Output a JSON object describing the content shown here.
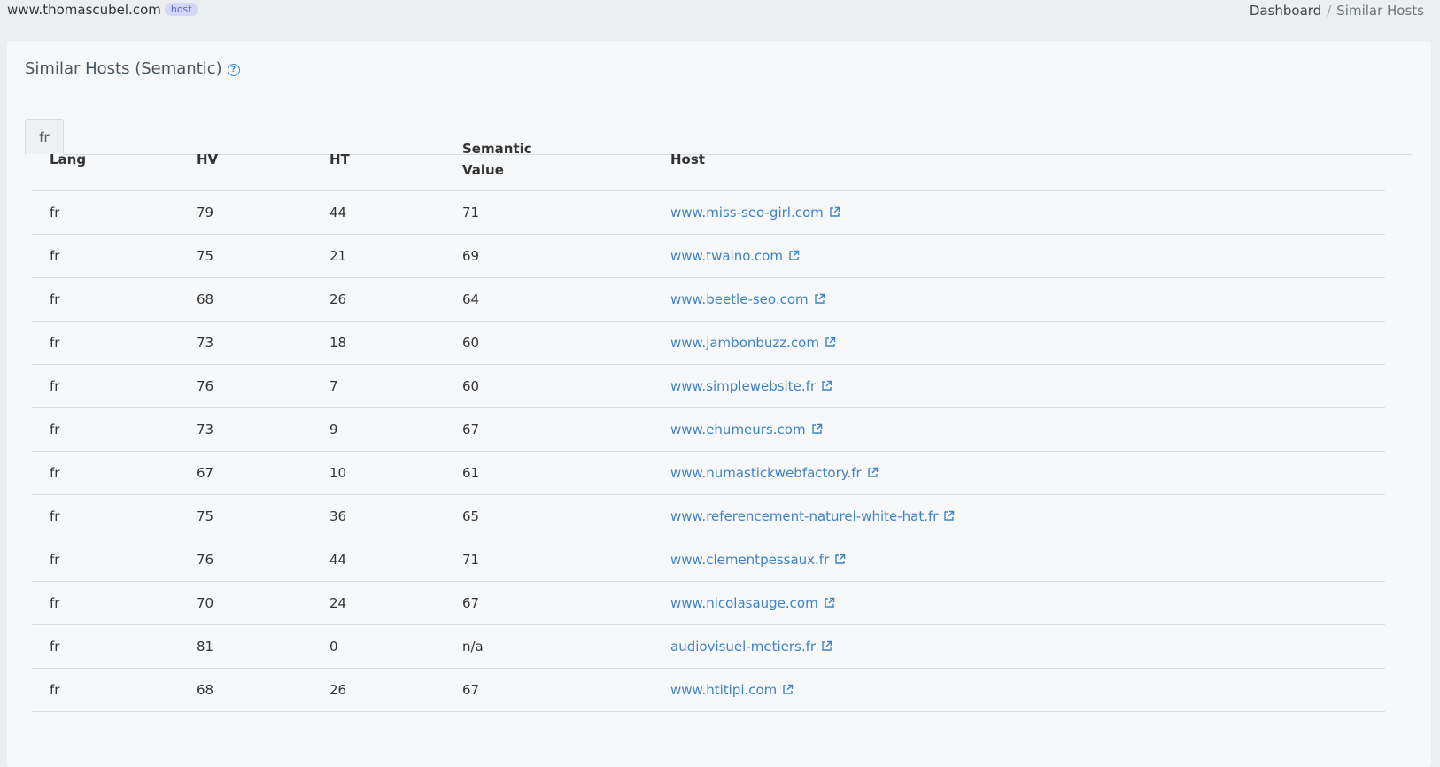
{
  "topbar": {
    "host": "www.thomascubel.com",
    "badge": "host",
    "breadcrumb": [
      "Dashboard",
      "Similar Hosts"
    ]
  },
  "card": {
    "title": "Similar Hosts (Semantic)",
    "help_icon": "question-circle-icon",
    "tabs": [
      {
        "label": "fr"
      }
    ]
  },
  "table": {
    "headers": [
      "Lang",
      "HV",
      "HT",
      "Semantic Value",
      "Host"
    ],
    "rows": [
      {
        "lang": "fr",
        "hv": "79",
        "ht": "44",
        "sem": "71",
        "host": "www.miss-seo-girl.com"
      },
      {
        "lang": "fr",
        "hv": "75",
        "ht": "21",
        "sem": "69",
        "host": "www.twaino.com"
      },
      {
        "lang": "fr",
        "hv": "68",
        "ht": "26",
        "sem": "64",
        "host": "www.beetle-seo.com"
      },
      {
        "lang": "fr",
        "hv": "73",
        "ht": "18",
        "sem": "60",
        "host": "www.jambonbuzz.com"
      },
      {
        "lang": "fr",
        "hv": "76",
        "ht": "7",
        "sem": "60",
        "host": "www.simplewebsite.fr"
      },
      {
        "lang": "fr",
        "hv": "73",
        "ht": "9",
        "sem": "67",
        "host": "www.ehumeurs.com"
      },
      {
        "lang": "fr",
        "hv": "67",
        "ht": "10",
        "sem": "61",
        "host": "www.numastickwebfactory.fr"
      },
      {
        "lang": "fr",
        "hv": "75",
        "ht": "36",
        "sem": "65",
        "host": "www.referencement-naturel-white-hat.fr"
      },
      {
        "lang": "fr",
        "hv": "76",
        "ht": "44",
        "sem": "71",
        "host": "www.clementpessaux.fr"
      },
      {
        "lang": "fr",
        "hv": "70",
        "ht": "24",
        "sem": "67",
        "host": "www.nicolasauge.com"
      },
      {
        "lang": "fr",
        "hv": "81",
        "ht": "0",
        "sem": "n/a",
        "host": "audiovisuel-metiers.fr"
      },
      {
        "lang": "fr",
        "hv": "68",
        "ht": "26",
        "sem": "67",
        "host": "www.htitipi.com"
      }
    ]
  },
  "colors": {
    "link": "#3f82c7",
    "badge_bg": "#d4d7f7",
    "badge_text": "#5b5fd8"
  }
}
